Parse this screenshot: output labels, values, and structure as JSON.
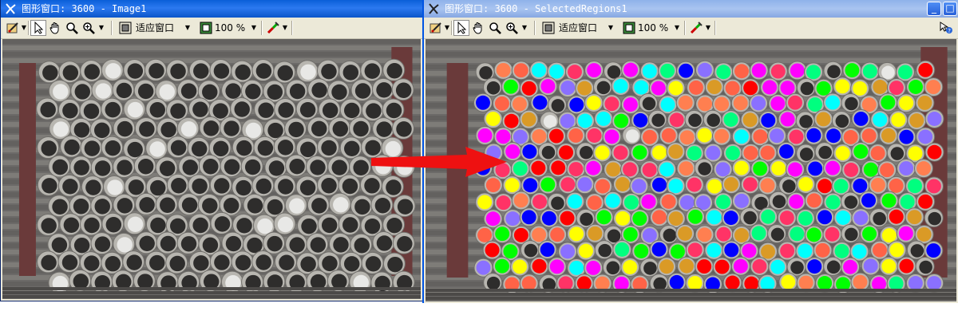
{
  "window_left": {
    "title": "图形窗口: 3600 - Image1",
    "zoom_mode": "适应窗口",
    "zoom_percent": "100 %"
  },
  "window_right": {
    "title": "图形窗口: 3600 - SelectedRegions1",
    "zoom_mode": "适应窗口",
    "zoom_percent": "100 %"
  },
  "titlebar_buttons": {
    "minimize": "_",
    "maximize": "□"
  },
  "colors": {
    "titlebar_active": "#0a5fd8",
    "titlebar_inactive": "#8fb2ea",
    "toolbar_bg": "#ece9d8",
    "arrow": "#ee1111",
    "pipe_metal": "#b8b6b0",
    "region_palette": [
      "#ff0000",
      "#00ff00",
      "#0000ff",
      "#00ffff",
      "#ff00ff",
      "#ffff00",
      "#ff7f50",
      "#da9a26",
      "#8a70ff",
      "#00ff7f",
      "#ff3366",
      "#ff6347"
    ]
  },
  "icons": [
    "draw-settings-icon",
    "pointer-icon",
    "pan-hand-icon",
    "zoom-magnifier-icon",
    "zoom-plus-icon",
    "fit-window-icon",
    "zoom-percent-icon",
    "color-picker-icon",
    "help-icon"
  ]
}
